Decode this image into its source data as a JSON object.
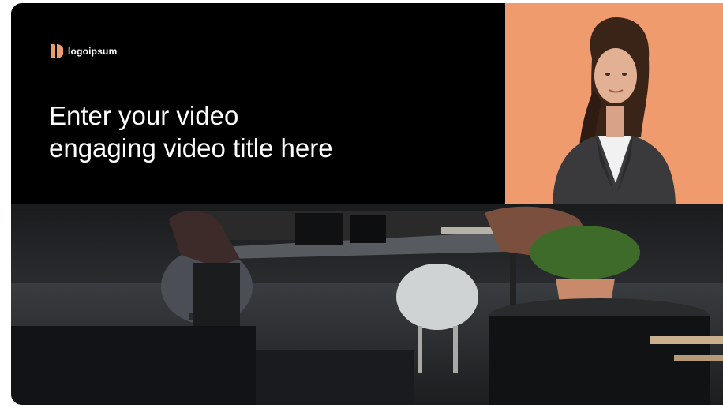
{
  "brand": {
    "logo_text": "logoipsum",
    "logo_mark_icon": "logoipsum-mark-icon",
    "accent_color": "#ef9b6e"
  },
  "hero": {
    "title_line_1": "Enter your video",
    "title_line_2": "engaging video title here"
  },
  "presenter": {
    "background_color": "#ef9b6e"
  },
  "background_scene": {
    "description_icon": "office-workspace-photo"
  }
}
